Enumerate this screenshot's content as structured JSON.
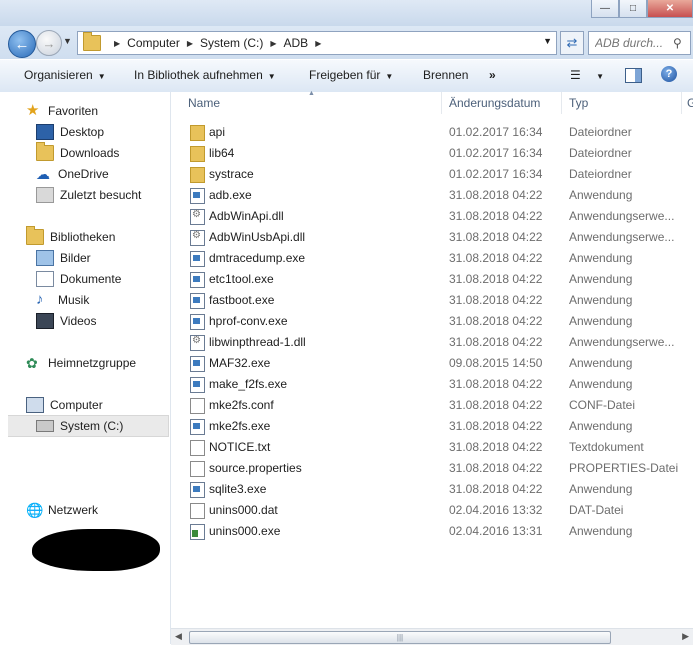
{
  "address": {
    "crumbs": [
      "Computer",
      "System (C:)",
      "ADB"
    ],
    "search_placeholder": "ADB durch..."
  },
  "toolbar": {
    "organize": "Organisieren",
    "library": "In Bibliothek aufnehmen",
    "share": "Freigeben für",
    "burn": "Brennen",
    "more": "»"
  },
  "nav": {
    "favorites": "Favoriten",
    "desktop": "Desktop",
    "downloads": "Downloads",
    "onedrive": "OneDrive",
    "recent": "Zuletzt besucht",
    "libraries": "Bibliotheken",
    "pictures": "Bilder",
    "documents": "Dokumente",
    "music": "Musik",
    "videos": "Videos",
    "homegroup": "Heimnetzgruppe",
    "computer": "Computer",
    "system": "System (C:)",
    "network": "Netzwerk"
  },
  "columns": {
    "name": "Name",
    "date": "Änderungsdatum",
    "type": "Typ",
    "size": "G"
  },
  "files": [
    {
      "name": "api",
      "date": "01.02.2017 16:34",
      "type": "Dateiordner",
      "icon": "folder"
    },
    {
      "name": "lib64",
      "date": "01.02.2017 16:34",
      "type": "Dateiordner",
      "icon": "folder"
    },
    {
      "name": "systrace",
      "date": "01.02.2017 16:34",
      "type": "Dateiordner",
      "icon": "folder"
    },
    {
      "name": "adb.exe",
      "date": "31.08.2018 04:22",
      "type": "Anwendung",
      "icon": "exe"
    },
    {
      "name": "AdbWinApi.dll",
      "date": "31.08.2018 04:22",
      "type": "Anwendungserwe...",
      "icon": "dll"
    },
    {
      "name": "AdbWinUsbApi.dll",
      "date": "31.08.2018 04:22",
      "type": "Anwendungserwe...",
      "icon": "dll"
    },
    {
      "name": "dmtracedump.exe",
      "date": "31.08.2018 04:22",
      "type": "Anwendung",
      "icon": "exe"
    },
    {
      "name": "etc1tool.exe",
      "date": "31.08.2018 04:22",
      "type": "Anwendung",
      "icon": "exe"
    },
    {
      "name": "fastboot.exe",
      "date": "31.08.2018 04:22",
      "type": "Anwendung",
      "icon": "exe"
    },
    {
      "name": "hprof-conv.exe",
      "date": "31.08.2018 04:22",
      "type": "Anwendung",
      "icon": "exe"
    },
    {
      "name": "libwinpthread-1.dll",
      "date": "31.08.2018 04:22",
      "type": "Anwendungserwe...",
      "icon": "dll"
    },
    {
      "name": "MAF32.exe",
      "date": "09.08.2015 14:50",
      "type": "Anwendung",
      "icon": "exe"
    },
    {
      "name": "make_f2fs.exe",
      "date": "31.08.2018 04:22",
      "type": "Anwendung",
      "icon": "exe"
    },
    {
      "name": "mke2fs.conf",
      "date": "31.08.2018 04:22",
      "type": "CONF-Datei",
      "icon": "doc"
    },
    {
      "name": "mke2fs.exe",
      "date": "31.08.2018 04:22",
      "type": "Anwendung",
      "icon": "exe"
    },
    {
      "name": "NOTICE.txt",
      "date": "31.08.2018 04:22",
      "type": "Textdokument",
      "icon": "doc"
    },
    {
      "name": "source.properties",
      "date": "31.08.2018 04:22",
      "type": "PROPERTIES-Datei",
      "icon": "doc"
    },
    {
      "name": "sqlite3.exe",
      "date": "31.08.2018 04:22",
      "type": "Anwendung",
      "icon": "exe"
    },
    {
      "name": "unins000.dat",
      "date": "02.04.2016 13:32",
      "type": "DAT-Datei",
      "icon": "doc"
    },
    {
      "name": "unins000.exe",
      "date": "02.04.2016 13:31",
      "type": "Anwendung",
      "icon": "setup"
    }
  ]
}
